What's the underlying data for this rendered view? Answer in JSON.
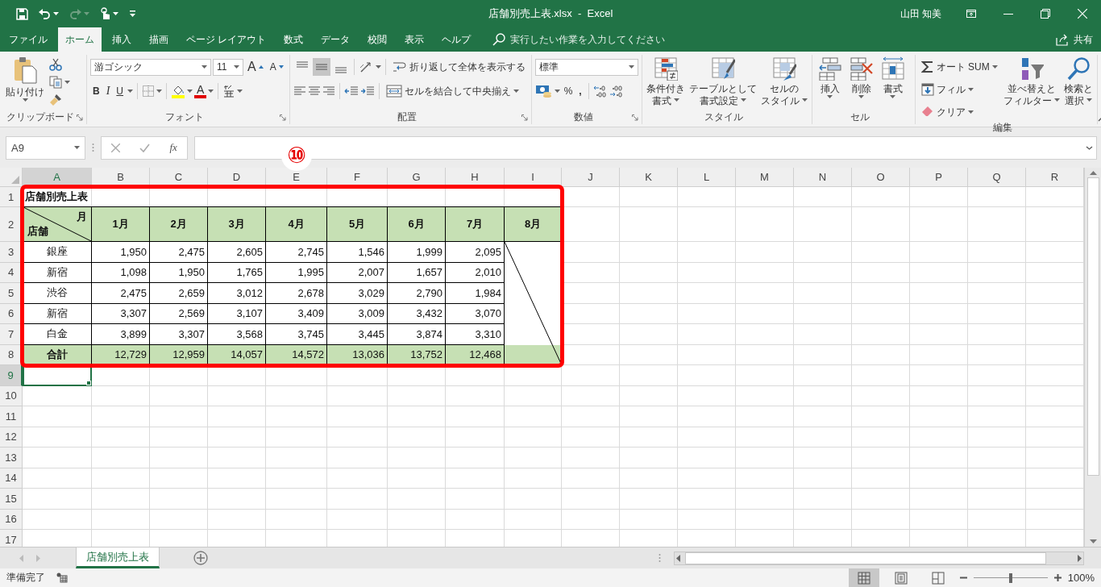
{
  "window": {
    "title": "店舗別売上表.xlsx  -  Excel",
    "user": "山田 知美"
  },
  "ribbon_tabs": [
    {
      "label": "ファイル",
      "selected": false
    },
    {
      "label": "ホーム",
      "selected": true
    },
    {
      "label": "挿入",
      "selected": false
    },
    {
      "label": "描画",
      "selected": false
    },
    {
      "label": "ページ レイアウト",
      "selected": false
    },
    {
      "label": "数式",
      "selected": false
    },
    {
      "label": "データ",
      "selected": false
    },
    {
      "label": "校閲",
      "selected": false
    },
    {
      "label": "表示",
      "selected": false
    },
    {
      "label": "ヘルプ",
      "selected": false
    }
  ],
  "tell_me": {
    "placeholder": "実行したい作業を入力してください"
  },
  "share_button": "共有",
  "ribbon": {
    "clipboard": {
      "label": "クリップボード",
      "paste": "貼り付け"
    },
    "font": {
      "label": "フォント",
      "font_name": "游ゴシック",
      "font_size": "11",
      "grow": "A",
      "shrink": "A",
      "bold": "B",
      "italic": "I",
      "underline": "U",
      "font_color": "A"
    },
    "alignment": {
      "label": "配置",
      "vertical_align": [
        {
          "kind": "top",
          "selected": false
        },
        {
          "kind": "middle",
          "selected": true
        },
        {
          "kind": "bottom",
          "selected": false
        }
      ],
      "wrap_text": "折り返して全体を表示する",
      "merge_center": "セルを結合して中央揃え"
    },
    "number": {
      "label": "数値",
      "format": "標準",
      "percent": "%",
      "comma": ","
    },
    "styles": {
      "label": "スタイル",
      "buttons": [
        {
          "kind": "conditional",
          "lines": [
            "条件付き",
            "書式"
          ]
        },
        {
          "kind": "table",
          "lines": [
            "テーブルとして",
            "書式設定"
          ]
        },
        {
          "kind": "cell_style",
          "lines": [
            "セルの",
            "スタイル"
          ]
        }
      ]
    },
    "cells": {
      "label": "セル",
      "buttons": [
        {
          "kind": "insert",
          "label": "挿入"
        },
        {
          "kind": "delete",
          "label": "削除"
        },
        {
          "kind": "format",
          "label": "書式"
        }
      ]
    },
    "editing": {
      "label": "編集",
      "small": [
        {
          "kind": "autosum",
          "label": "オート SUM"
        },
        {
          "kind": "fill",
          "label": "フィル"
        },
        {
          "kind": "clear",
          "label": "クリア"
        }
      ],
      "big": [
        {
          "kind": "sort",
          "lines": [
            "並べ替えと",
            "フィルター"
          ]
        },
        {
          "kind": "find",
          "lines": [
            "検索と",
            "選択"
          ]
        }
      ]
    }
  },
  "formula_bar": {
    "name_box": "A9",
    "function_label": "fx"
  },
  "annotation": {
    "step": "⑩",
    "frame": true
  },
  "columns": [
    {
      "label": "A",
      "selected": true
    },
    {
      "label": "B",
      "selected": false
    },
    {
      "label": "C",
      "selected": false
    },
    {
      "label": "D",
      "selected": false
    },
    {
      "label": "E",
      "selected": false
    },
    {
      "label": "F",
      "selected": false
    },
    {
      "label": "G",
      "selected": false
    },
    {
      "label": "H",
      "selected": false
    },
    {
      "label": "I",
      "selected": false
    },
    {
      "label": "J",
      "selected": false
    },
    {
      "label": "K",
      "selected": false
    },
    {
      "label": "L",
      "selected": false
    },
    {
      "label": "M",
      "selected": false
    },
    {
      "label": "N",
      "selected": false
    },
    {
      "label": "O",
      "selected": false
    },
    {
      "label": "P",
      "selected": false
    },
    {
      "label": "Q",
      "selected": false
    },
    {
      "label": "R",
      "selected": false
    }
  ],
  "rows": [
    {
      "label": "1",
      "selected": false
    },
    {
      "label": "2",
      "selected": false
    },
    {
      "label": "3",
      "selected": false
    },
    {
      "label": "4",
      "selected": false
    },
    {
      "label": "5",
      "selected": false
    },
    {
      "label": "6",
      "selected": false
    },
    {
      "label": "7",
      "selected": false
    },
    {
      "label": "8",
      "selected": false
    },
    {
      "label": "9",
      "selected": true
    },
    {
      "label": "10",
      "selected": false
    },
    {
      "label": "11",
      "selected": false
    },
    {
      "label": "12",
      "selected": false
    },
    {
      "label": "13",
      "selected": false
    },
    {
      "label": "14",
      "selected": false
    },
    {
      "label": "15",
      "selected": false
    },
    {
      "label": "16",
      "selected": false
    },
    {
      "label": "17",
      "selected": false
    }
  ],
  "table": {
    "title": "店舗別売上表",
    "corner": {
      "top": "月",
      "bottom": "店舗"
    },
    "months": [
      "1月",
      "2月",
      "3月",
      "4月",
      "5月",
      "6月",
      "7月",
      "8月"
    ],
    "rows": [
      {
        "store": "銀座",
        "values": [
          "1,950",
          "2,475",
          "2,605",
          "2,745",
          "1,546",
          "1,999",
          "2,095"
        ]
      },
      {
        "store": "新宿",
        "values": [
          "1,098",
          "1,950",
          "1,765",
          "1,995",
          "2,007",
          "1,657",
          "2,010"
        ]
      },
      {
        "store": "渋谷",
        "values": [
          "2,475",
          "2,659",
          "3,012",
          "2,678",
          "3,029",
          "2,790",
          "1,984"
        ]
      },
      {
        "store": "新宿",
        "values": [
          "3,307",
          "2,569",
          "3,107",
          "3,409",
          "3,009",
          "3,432",
          "3,070"
        ]
      },
      {
        "store": "白金",
        "values": [
          "3,899",
          "3,307",
          "3,568",
          "3,745",
          "3,445",
          "3,874",
          "3,310"
        ]
      }
    ],
    "total": {
      "label": "合計",
      "values": [
        "12,729",
        "12,959",
        "14,057",
        "14,572",
        "13,036",
        "13,752",
        "12,468"
      ]
    }
  },
  "sheet_tabs": [
    {
      "label": "店舗別売上表",
      "selected": true
    }
  ],
  "status_bar": {
    "status": "準備完了",
    "views": [
      {
        "kind": "normal",
        "selected": true
      },
      {
        "kind": "page_layout",
        "selected": false
      },
      {
        "kind": "page_break",
        "selected": false
      }
    ],
    "zoom_slider": {
      "level": 0.5
    },
    "zoom": "100%"
  }
}
